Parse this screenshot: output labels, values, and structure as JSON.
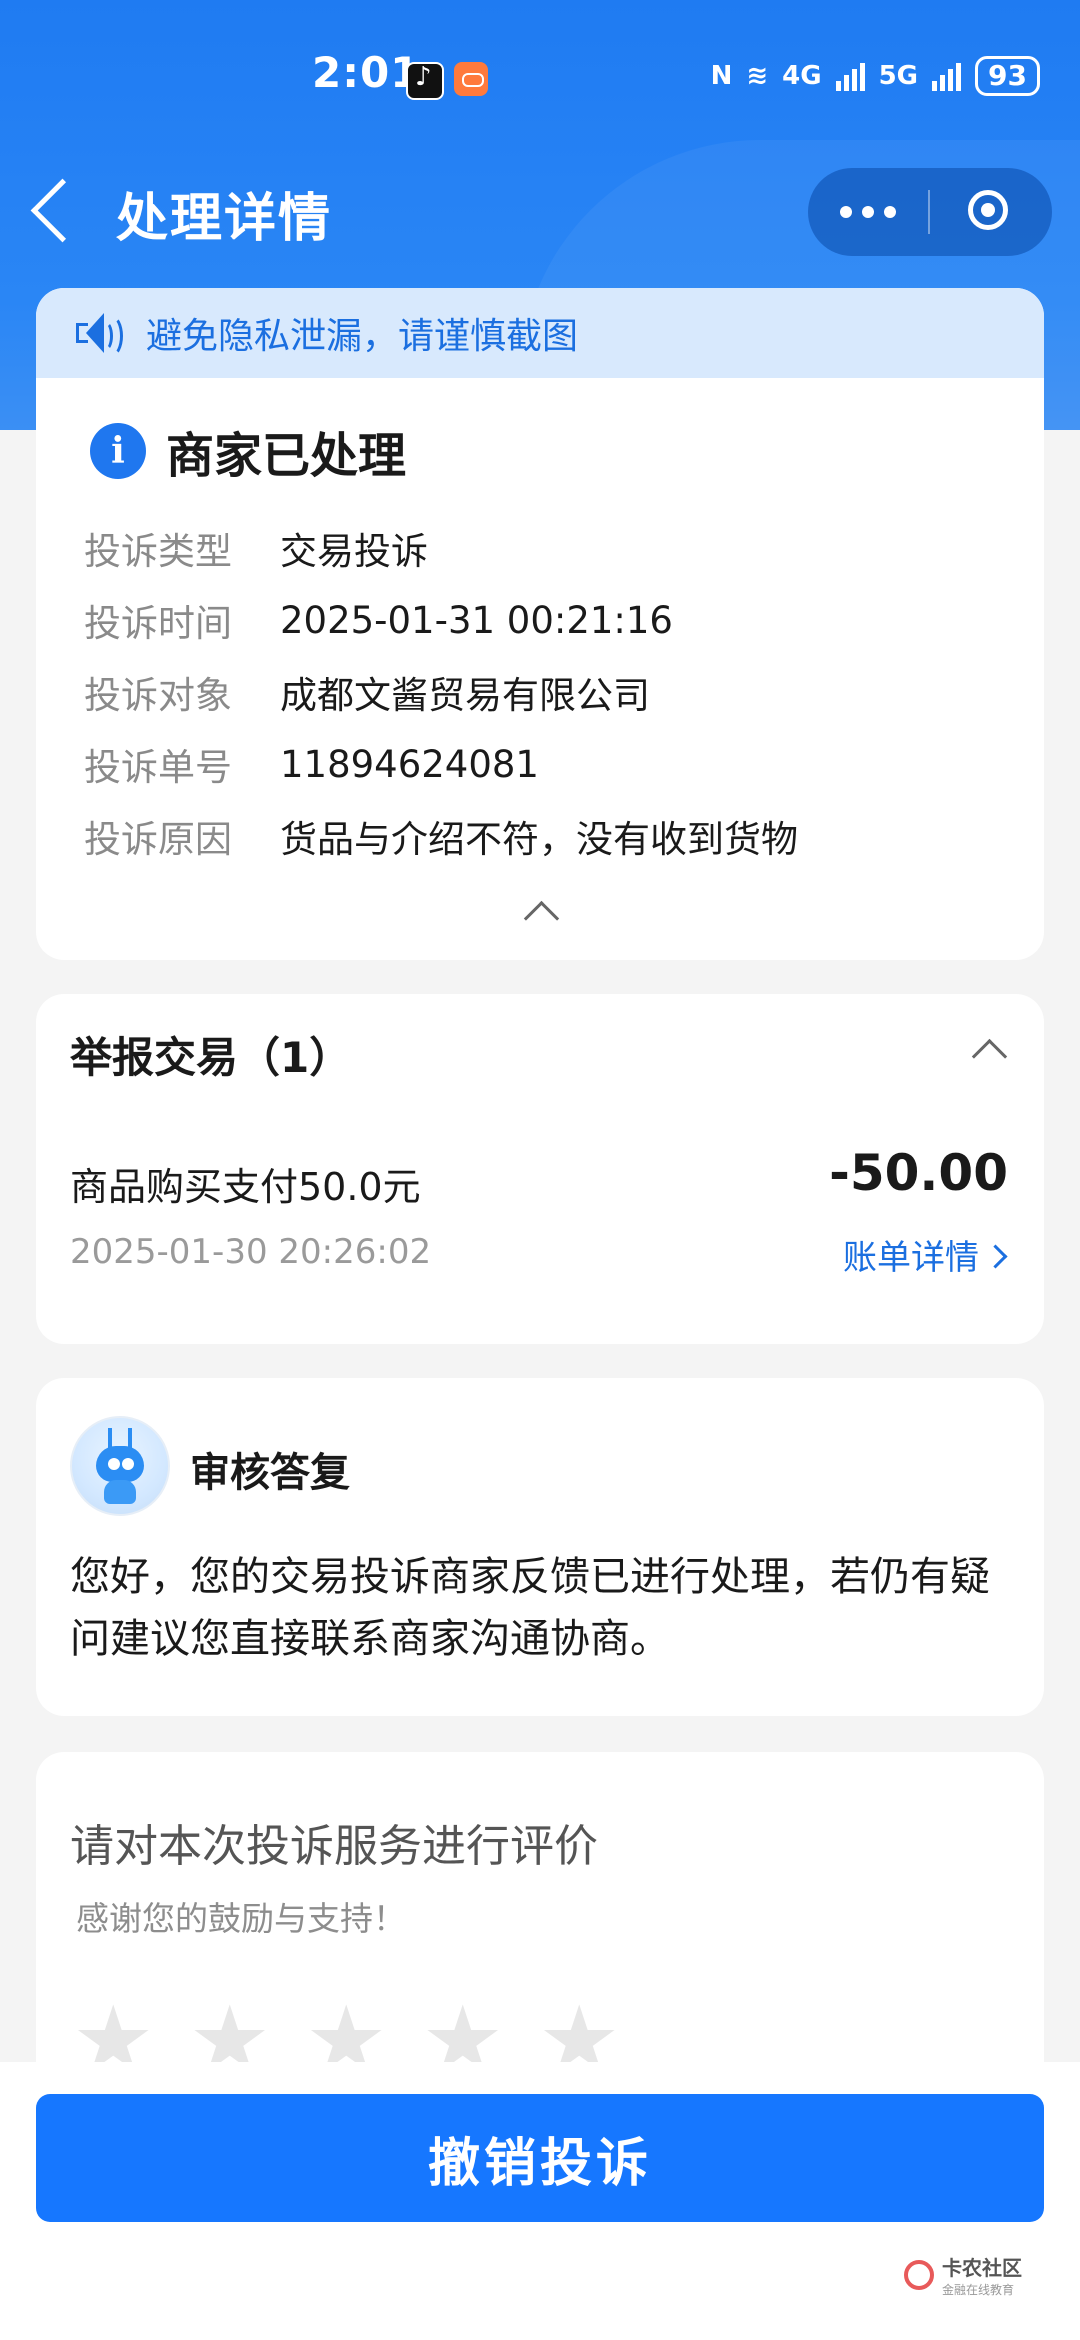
{
  "status_bar": {
    "time": "2:01",
    "network_4g": "4G",
    "network_5g": "5G",
    "battery": "93"
  },
  "nav": {
    "title": "处理详情"
  },
  "notice": {
    "text": "避免隐私泄漏，请谨慎截图"
  },
  "complaint": {
    "status_title": "商家已处理",
    "fields": [
      {
        "label": "投诉类型",
        "value": "交易投诉"
      },
      {
        "label": "投诉时间",
        "value": "2025-01-31 00:21:16"
      },
      {
        "label": "投诉对象",
        "value": "成都文酱贸易有限公司"
      },
      {
        "label": "投诉单号",
        "value": "11894624081"
      },
      {
        "label": "投诉原因",
        "value": "货品与介绍不符，没有收到货物"
      }
    ]
  },
  "transactions": {
    "title": "举报交易（1）",
    "item": {
      "name": "商品购买支付50.0元",
      "amount": "-50.00",
      "date": "2025-01-30 20:26:02",
      "link": "账单详情"
    }
  },
  "reply": {
    "title": "审核答复",
    "text": "您好，您的交易投诉商家反馈已进行处理，若仍有疑问建议您直接联系商家沟通协商。"
  },
  "rating": {
    "title": "请对本次投诉服务进行评价",
    "subtitle": "感谢您的鼓励与支持！",
    "stars_selected": 0,
    "stars_total": 5
  },
  "bottom": {
    "cancel_label": "撤销投诉"
  },
  "watermark": {
    "name": "卡农社区",
    "tagline": "金融在线教育"
  }
}
